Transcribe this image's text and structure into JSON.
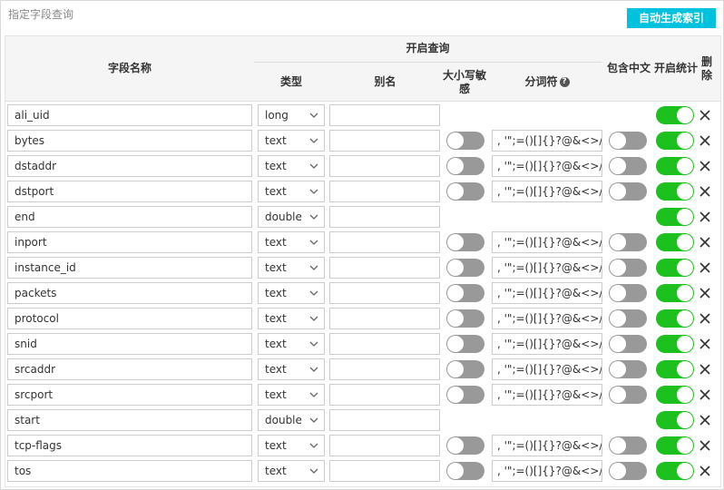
{
  "panel": {
    "title": "指定字段查询",
    "generate_button": "自动生成索引"
  },
  "header": {
    "field_name": "字段名称",
    "enable_query": "开启查询",
    "type": "类型",
    "alias": "别名",
    "case_sensitive": "大小写敏感",
    "tokenizer": "分词符",
    "include_chinese": "包含中文",
    "enable_stats": "开启统计",
    "delete": "删除"
  },
  "icons": {
    "help": "help-icon",
    "dropdown": "chevron-down-icon",
    "delete": "close-icon"
  },
  "colors": {
    "switch_on": "#1dc11d",
    "switch_off": "#999999",
    "button": "#00c1de"
  },
  "rows": [
    {
      "name": "ali_uid",
      "type": "long",
      "alias": "",
      "has_text_opts": false,
      "case_sensitive": false,
      "tokenizer": "",
      "include_chinese": false,
      "enable_stats": true
    },
    {
      "name": "bytes",
      "type": "text",
      "alias": "",
      "has_text_opts": true,
      "case_sensitive": false,
      "tokenizer": ", '\";=()[]{}?@&<>/:\\n",
      "include_chinese": false,
      "enable_stats": true
    },
    {
      "name": "dstaddr",
      "type": "text",
      "alias": "",
      "has_text_opts": true,
      "case_sensitive": false,
      "tokenizer": ", '\";=()[]{}?@&<>/:\\n",
      "include_chinese": false,
      "enable_stats": true
    },
    {
      "name": "dstport",
      "type": "text",
      "alias": "",
      "has_text_opts": true,
      "case_sensitive": false,
      "tokenizer": ", '\";=()[]{}?@&<>/:\\n",
      "include_chinese": false,
      "enable_stats": true
    },
    {
      "name": "end",
      "type": "double",
      "alias": "",
      "has_text_opts": false,
      "case_sensitive": false,
      "tokenizer": "",
      "include_chinese": false,
      "enable_stats": true
    },
    {
      "name": "inport",
      "type": "text",
      "alias": "",
      "has_text_opts": true,
      "case_sensitive": false,
      "tokenizer": ", '\";=()[]{}?@&<>/:\\n",
      "include_chinese": false,
      "enable_stats": true
    },
    {
      "name": "instance_id",
      "type": "text",
      "alias": "",
      "has_text_opts": true,
      "case_sensitive": false,
      "tokenizer": ", '\";=()[]{}?@&<>/:\\n",
      "include_chinese": false,
      "enable_stats": true
    },
    {
      "name": "packets",
      "type": "text",
      "alias": "",
      "has_text_opts": true,
      "case_sensitive": false,
      "tokenizer": ", '\";=()[]{}?@&<>/:\\n",
      "include_chinese": false,
      "enable_stats": true
    },
    {
      "name": "protocol",
      "type": "text",
      "alias": "",
      "has_text_opts": true,
      "case_sensitive": false,
      "tokenizer": ", '\";=()[]{}?@&<>/:\\n",
      "include_chinese": false,
      "enable_stats": true
    },
    {
      "name": "snid",
      "type": "text",
      "alias": "",
      "has_text_opts": true,
      "case_sensitive": false,
      "tokenizer": ", '\";=()[]{}?@&<>/:\\n",
      "include_chinese": false,
      "enable_stats": true
    },
    {
      "name": "srcaddr",
      "type": "text",
      "alias": "",
      "has_text_opts": true,
      "case_sensitive": false,
      "tokenizer": ", '\";=()[]{}?@&<>/:\\n",
      "include_chinese": false,
      "enable_stats": true
    },
    {
      "name": "srcport",
      "type": "text",
      "alias": "",
      "has_text_opts": true,
      "case_sensitive": false,
      "tokenizer": ", '\";=()[]{}?@&<>/:\\n",
      "include_chinese": false,
      "enable_stats": true
    },
    {
      "name": "start",
      "type": "double",
      "alias": "",
      "has_text_opts": false,
      "case_sensitive": false,
      "tokenizer": "",
      "include_chinese": false,
      "enable_stats": true
    },
    {
      "name": "tcp-flags",
      "type": "text",
      "alias": "",
      "has_text_opts": true,
      "case_sensitive": false,
      "tokenizer": ", '\";=()[]{}?@&<>/:\\n",
      "include_chinese": false,
      "enable_stats": true
    },
    {
      "name": "tos",
      "type": "text",
      "alias": "",
      "has_text_opts": true,
      "case_sensitive": false,
      "tokenizer": ", '\";=()[]{}?@&<>/:\\n",
      "include_chinese": false,
      "enable_stats": true
    }
  ]
}
